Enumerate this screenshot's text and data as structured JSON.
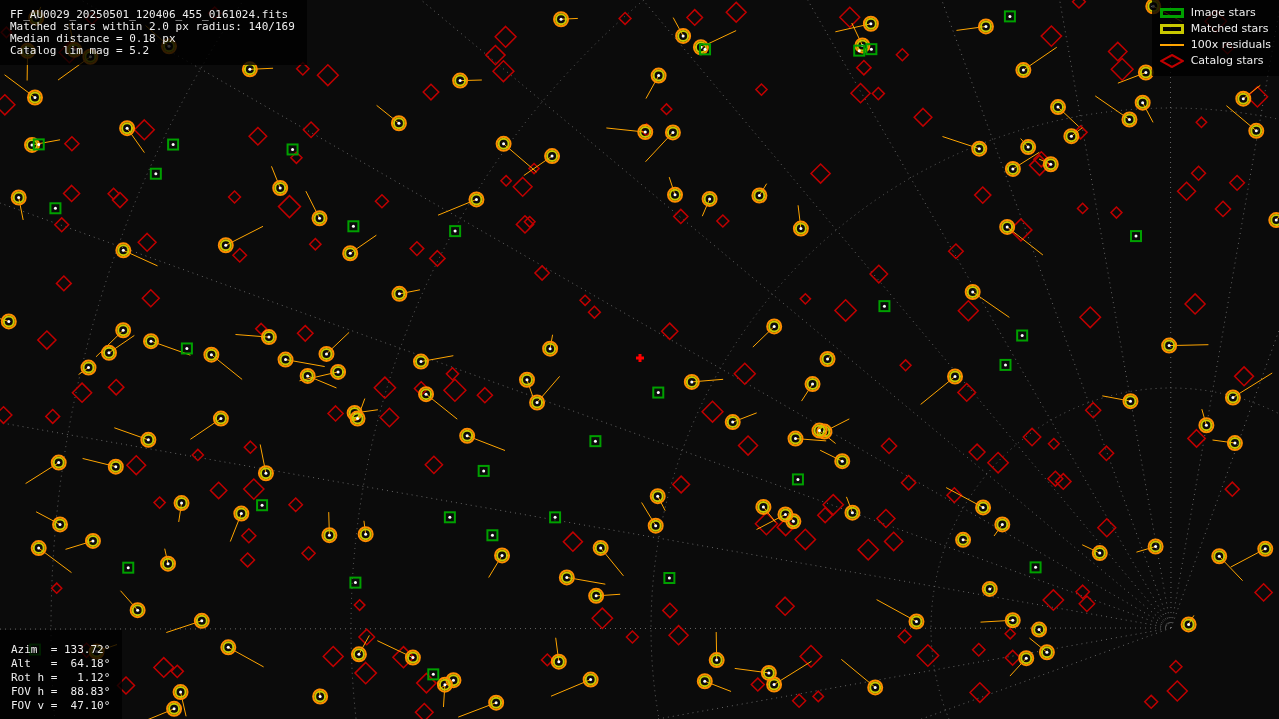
{
  "info_lines": [
    "FF_AU0029_20250501_120406_455_0161024.fits",
    "Matched stars within 2.0 px radius: 140/169",
    "Median distance = 0.18 px",
    "Catalog lim mag = 5.2"
  ],
  "legend": [
    {
      "kind": "box",
      "label": "Image stars",
      "color": "#00a000"
    },
    {
      "kind": "box",
      "label": "Matched stars",
      "color": "#c8c800"
    },
    {
      "kind": "line",
      "label": "100x residuals",
      "color": "#ffa500"
    },
    {
      "kind": "diamond",
      "label": "Catalog stars",
      "color": "#c00000"
    }
  ],
  "pointing": [
    "Azim  = 133.72°",
    "Alt   =  64.18°",
    "Rot h =   1.12°",
    "FOV h =  88.83°",
    "FOV v =  47.10°"
  ]
}
